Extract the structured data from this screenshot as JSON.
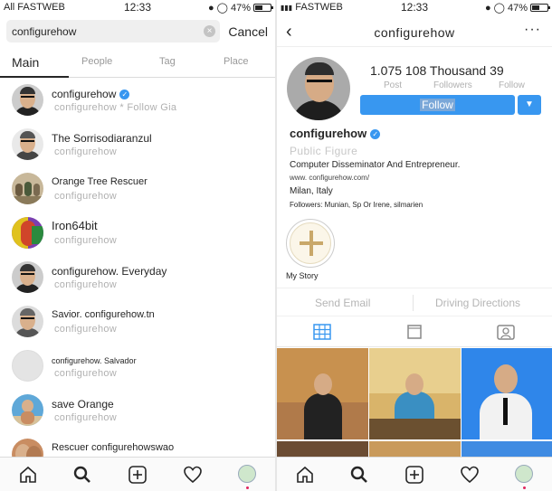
{
  "left": {
    "status": {
      "carrier": "All FASTWEB",
      "time": "12:33",
      "battery": "47%"
    },
    "search": {
      "value": "configurehow",
      "cancel_label": "Cancel"
    },
    "tabs": [
      {
        "label": "Main"
      },
      {
        "label": "People"
      },
      {
        "label": "Tag"
      },
      {
        "label": "Place"
      }
    ],
    "results": [
      {
        "name": "configurehow",
        "sub": "configurehow * Follow Gia",
        "verified": true,
        "avatar": "man-glasses"
      },
      {
        "name": "The Sorrisodiaranzul",
        "sub": "configurehow",
        "verified": false,
        "avatar": "man-glasses"
      },
      {
        "name": "Orange Tree Rescuer",
        "sub": "configurehow",
        "verified": false,
        "avatar": "group-photo"
      },
      {
        "name": "Iron64bit",
        "sub": "configurehow",
        "verified": false,
        "avatar": "colorful"
      },
      {
        "name": "configurehow. Everyday",
        "sub": "configurehow",
        "verified": false,
        "avatar": "man-glasses"
      },
      {
        "name": "Savior. configurehow.tn",
        "sub": "configurehow",
        "verified": false,
        "avatar": "man-glasses"
      },
      {
        "name": "configurehow. Salvador",
        "sub": "configurehow",
        "verified": false,
        "avatar": "blank"
      },
      {
        "name": "save Orange",
        "sub": "configurehow",
        "verified": false,
        "avatar": "beach-man"
      },
      {
        "name": "Rescuer configurehowswao",
        "sub": "",
        "verified": false,
        "avatar": "man-glasses"
      }
    ],
    "tabbar": {
      "icons": [
        "home-icon",
        "search-icon",
        "add-icon",
        "heart-icon",
        "profile-icon"
      ]
    }
  },
  "right": {
    "status": {
      "carrier": "FASTWEB",
      "time": "12:33",
      "battery": "47%"
    },
    "nav": {
      "title": "configurehow",
      "more": "···",
      "back": "‹"
    },
    "stats": {
      "numbers": "1.075 108 Thousand 39",
      "post_label": "Post",
      "followers_label": "Followers",
      "following_label": "Follow"
    },
    "follow_label": "Follow",
    "bio": {
      "username": "configurehow",
      "category": "Public Figure",
      "description": "Computer Disseminator And Entrepreneur.",
      "link": "www. configurehow.com/",
      "location": "Milan, Italy",
      "followers_note": "Followers: Munian, Sp Or Irene, silmarien"
    },
    "highlight": {
      "label": "My Story"
    },
    "actions": {
      "email": "Send Email",
      "directions": "Driving Directions"
    },
    "tabbar": {
      "icons": [
        "home-icon",
        "search-icon",
        "add-icon",
        "heart-icon",
        "profile-icon"
      ]
    }
  },
  "colors": {
    "accent": "#3897f0",
    "notification": "#e0245e"
  }
}
